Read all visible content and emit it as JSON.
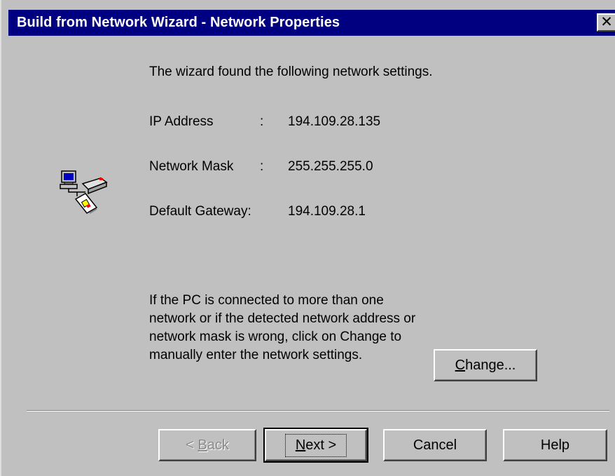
{
  "window": {
    "title": "Build from Network Wizard - Network Properties",
    "close_glyph": "✕"
  },
  "intro": "The wizard found the following network settings.",
  "settings": {
    "ip_label": "IP Address",
    "ip_sep": ":",
    "ip_value": "194.109.28.135",
    "mask_label": "Network Mask",
    "mask_sep": ":",
    "mask_value": "255.255.255.0",
    "gateway_label": "Default Gateway:",
    "gateway_value": "194.109.28.1"
  },
  "note": "If the PC is connected to more than one network or if the detected network address or network mask is wrong, click on Change to manually enter the network settings.",
  "change_button": {
    "mnemonic": "C",
    "rest": "hange..."
  },
  "buttons": {
    "back": {
      "prefix": "< ",
      "mnemonic": "B",
      "rest": "ack"
    },
    "next": {
      "mnemonic": "N",
      "rest": "ext >"
    },
    "cancel": "Cancel",
    "help": "Help"
  },
  "icons": {
    "network": "network-computer-icon"
  }
}
